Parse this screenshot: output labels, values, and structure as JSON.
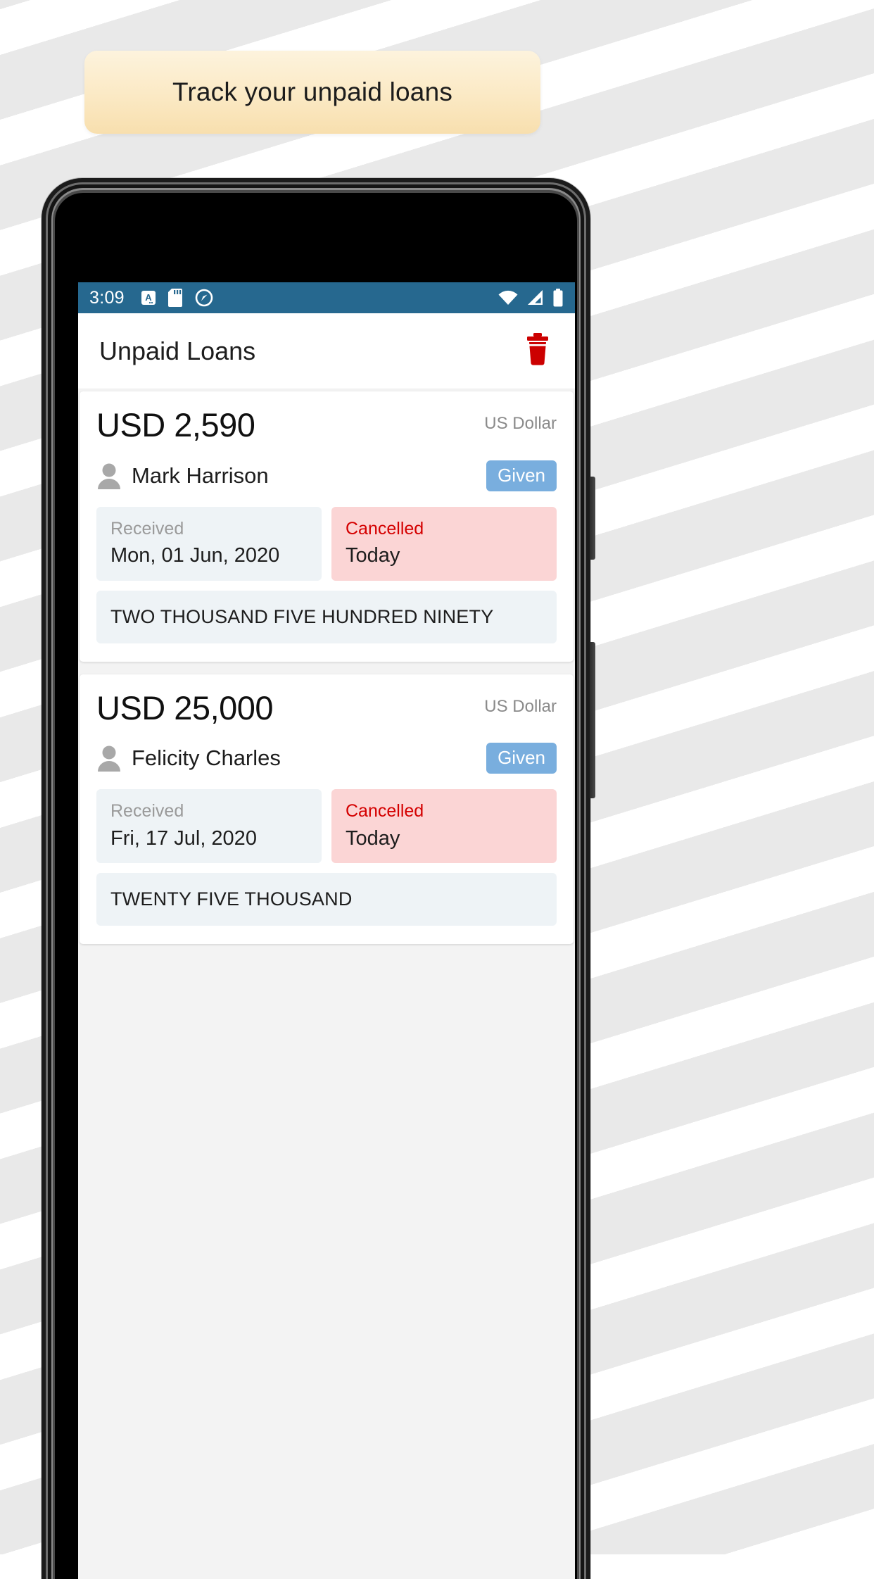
{
  "banner": {
    "text": "Track your unpaid loans"
  },
  "statusbar": {
    "time": "3:09",
    "left_icons": [
      "alphabet-mode-icon",
      "sd-card-icon",
      "location-off-icon"
    ],
    "right_icons": [
      "wifi-icon",
      "cellular-signal-icon",
      "battery-icon"
    ],
    "background_color": "#26688f"
  },
  "appbar": {
    "title": "Unpaid Loans",
    "delete_icon": "trash-icon",
    "delete_icon_color": "#cc0000"
  },
  "theme": {
    "accent": "#26688f",
    "chip_given": "#79aede",
    "chip_received_bg": "#eef3f6",
    "chip_cancelled_bg": "#fbd5d5",
    "cancelled_text": "#d40000",
    "screen_bg": "#f3f3f3"
  },
  "loans": [
    {
      "amount": "USD 2,590",
      "currency_name": "US Dollar",
      "person": "Mark Harrison",
      "person_icon": "person-icon",
      "status": "Given",
      "received_label": "Received",
      "received_date": "Mon, 01 Jun, 2020",
      "cancelled_label": "Cancelled",
      "cancelled_date": "Today",
      "amount_in_words": "TWO THOUSAND FIVE HUNDRED NINETY"
    },
    {
      "amount": "USD 25,000",
      "currency_name": "US Dollar",
      "person": "Felicity Charles",
      "person_icon": "person-icon",
      "status": "Given",
      "received_label": "Received",
      "received_date": "Fri, 17 Jul, 2020",
      "cancelled_label": "Cancelled",
      "cancelled_date": "Today",
      "amount_in_words": "TWENTY FIVE THOUSAND"
    }
  ]
}
